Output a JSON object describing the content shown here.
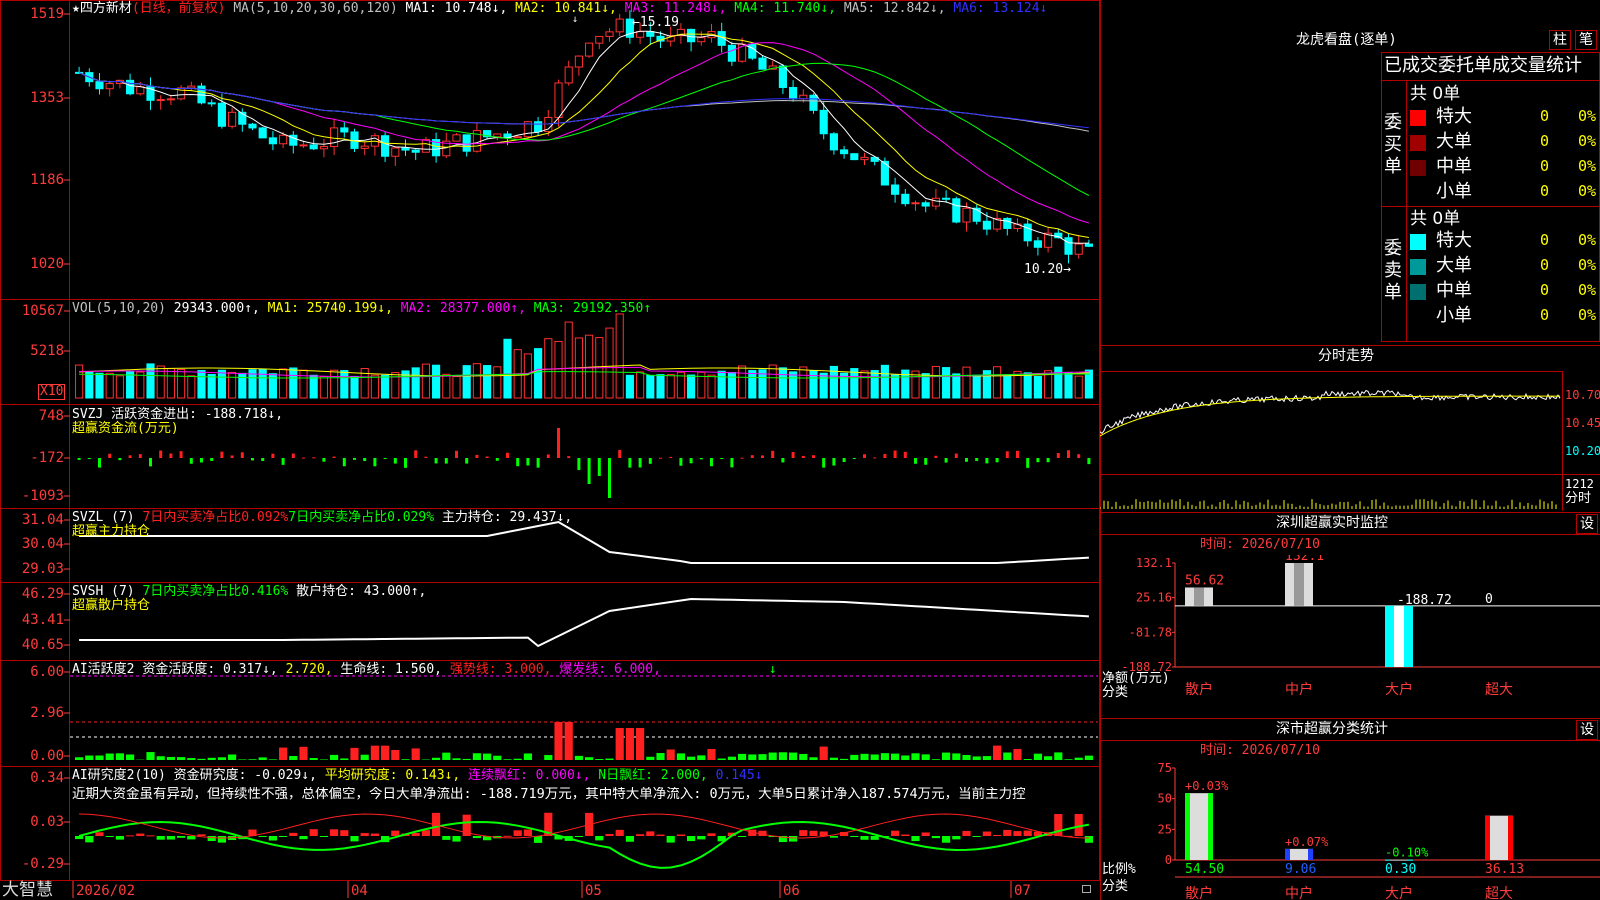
{
  "app": {
    "brand": "大智慧"
  },
  "stock": {
    "star": "★",
    "name": "四方新材",
    "mode": "(日线，前复权)"
  },
  "ma_legend": {
    "head": "MA(5,10,20,30,60,120)",
    "items": [
      {
        "label": "MA1: 10.748↓,",
        "color": "#ffffff"
      },
      {
        "label": "MA2: 10.841↓,",
        "color": "#ffff00"
      },
      {
        "label": "MA3: 11.248↓,",
        "color": "#ff00ff"
      },
      {
        "label": "MA4: 11.740↓,",
        "color": "#00ff00"
      },
      {
        "label": "MA5: 12.842↓,",
        "color": "#c0c0c0"
      },
      {
        "label": "MA6: 13.124↓",
        "color": "#3030ff"
      }
    ]
  },
  "price_chart": {
    "y_ticks": [
      "1519",
      "1353",
      "1186",
      "1020"
    ],
    "high_label": "15.19",
    "low_label": "10.20"
  },
  "vol_panel": {
    "y_ticks": [
      "10567",
      "5218"
    ],
    "unit": "X10",
    "legend": [
      {
        "label": "VOL(5,10,20)",
        "color": "#c0c0c0"
      },
      {
        "label": "29343.000↑,",
        "color": "#ffffff"
      },
      {
        "label": "MA1: 25740.199↓,",
        "color": "#ffff00"
      },
      {
        "label": "MA2: 28377.000↑,",
        "color": "#ff00ff"
      },
      {
        "label": "MA3: 29192.350↑",
        "color": "#00ff00"
      }
    ]
  },
  "svzj_panel": {
    "y_ticks": [
      "748",
      "-172",
      "-1093"
    ],
    "legend1": "SVZJ  活跃资金进出: -188.718↓,",
    "legend2": "超赢资金流(万元)"
  },
  "svzl_panel": {
    "y_ticks": [
      "31.04",
      "30.04",
      "29.03"
    ],
    "legend_a": "SVZL (7)",
    "legend_b": "7日内买卖净占比0.092%",
    "legend_c": "7日内买卖净占比0.029%",
    "legend_d": "主力持仓: 29.437↓,",
    "legend2": "超赢主力持仓"
  },
  "svsh_panel": {
    "y_ticks": [
      "46.29",
      "43.41",
      "40.65"
    ],
    "legend_a": "SVSH (7)",
    "legend_b": "7日内买卖净占比0.416%",
    "legend_c": "散户持仓: 43.000↑,",
    "legend2": "超赢散户持仓"
  },
  "ai_active_panel": {
    "y_ticks": [
      "6.00",
      "2.96",
      "0.00"
    ],
    "legend_a": "AI活跃度2",
    "legend_b": "资金活跃度: 0.317↓,",
    "legend_c": "2.720,",
    "legend_d": "生命线: 1.560,",
    "legend_e": "强势线: 3.000,",
    "legend_f": "爆发线: 6.000,"
  },
  "ai_research_panel": {
    "y_ticks": [
      "0.34",
      "0.03",
      "-0.29"
    ],
    "legend_a": "AI研究度2(10)",
    "legend_b": "资金研究度: -0.029↓,",
    "legend_c": "平均研究度: 0.143↓,",
    "legend_d": "连续飘红: 0.000↓,",
    "legend_e": "N日飘红: 2.000,",
    "legend_f": "0.145↓",
    "comment": "近期大资金虽有异动，但持续性不强，总体偏空，今日大单净流出: -188.719万元，其中特大单净流入: 0万元，大单5日累计净入187.574万元，当前主力控"
  },
  "x_axis": [
    "2026/02",
    "04",
    "05",
    "06",
    "07"
  ],
  "dragon": {
    "title": "龙虎看盘(逐单)",
    "btn_bar": "柱",
    "btn_pen": "笔",
    "tabs": "已成交委托单成交量统计",
    "buy_side": "委买单",
    "sell_side": "委卖单",
    "buy_total": "共 0单",
    "sell_total": "共 0单",
    "buy_rows": [
      {
        "label": "特大",
        "count": "0",
        "pct": "0%",
        "color": "#ff0000"
      },
      {
        "label": "大单",
        "count": "0",
        "pct": "0%",
        "color": "#a00000"
      },
      {
        "label": "中单",
        "count": "0",
        "pct": "0%",
        "color": "#700000"
      },
      {
        "label": "小单",
        "count": "0",
        "pct": "0%",
        "color": "#000000"
      }
    ],
    "sell_rows": [
      {
        "label": "特大",
        "count": "0",
        "pct": "0%",
        "color": "#00ffff"
      },
      {
        "label": "大单",
        "count": "0",
        "pct": "0%",
        "color": "#009999"
      },
      {
        "label": "中单",
        "count": "0",
        "pct": "0%",
        "color": "#006f6f"
      },
      {
        "label": "小单",
        "count": "0",
        "pct": "0%",
        "color": "#000000"
      }
    ]
  },
  "intraday": {
    "title": "分时走势",
    "price_ticks": [
      "10.70",
      "10.45",
      "10.20"
    ],
    "vol_tick": "1212",
    "vol_label": "分时"
  },
  "sz_monitor": {
    "title": "深圳超赢实时监控",
    "set": "设",
    "time": "时间: 2026/07/10",
    "y_ticks": [
      "132.1",
      "25.16",
      "-81.78",
      "-188.72"
    ],
    "y_unit1": "净额(万元)",
    "y_unit2": "分类",
    "bars": [
      {
        "cat": "散户",
        "value": 56.62,
        "label": "56.62"
      },
      {
        "cat": "中户",
        "value": 132.1,
        "label": "132.1"
      },
      {
        "cat": "大户",
        "value": -188.72,
        "label": "-188.72"
      },
      {
        "cat": "超大",
        "value": 0,
        "label": "0"
      }
    ]
  },
  "sz_classify": {
    "title": "深市超赢分类统计",
    "set": "设",
    "time": "时间: 2026/07/10",
    "y_ticks": [
      "75",
      "50",
      "25",
      "0"
    ],
    "y_unit1": "比例%",
    "y_unit2": "分类",
    "bars": [
      {
        "cat": "散户",
        "value": 54.5,
        "label": "54.50",
        "delta": "+0.03%",
        "color": "#00ff00",
        "cat_color": "#ff3b3b"
      },
      {
        "cat": "中户",
        "value": 9.06,
        "label": "9.06",
        "delta": "+0.07%",
        "color": "#2040ff",
        "cat_color": "#ff3b3b"
      },
      {
        "cat": "大户",
        "value": 0.3,
        "label": "0.30",
        "delta": "-0.10%",
        "color": "#00ffff",
        "cat_color": "#ff3b3b"
      },
      {
        "cat": "超大",
        "value": 36.13,
        "label": "36.13",
        "delta": "",
        "color": "#ff0000",
        "cat_color": "#ff3b3b"
      }
    ]
  }
}
